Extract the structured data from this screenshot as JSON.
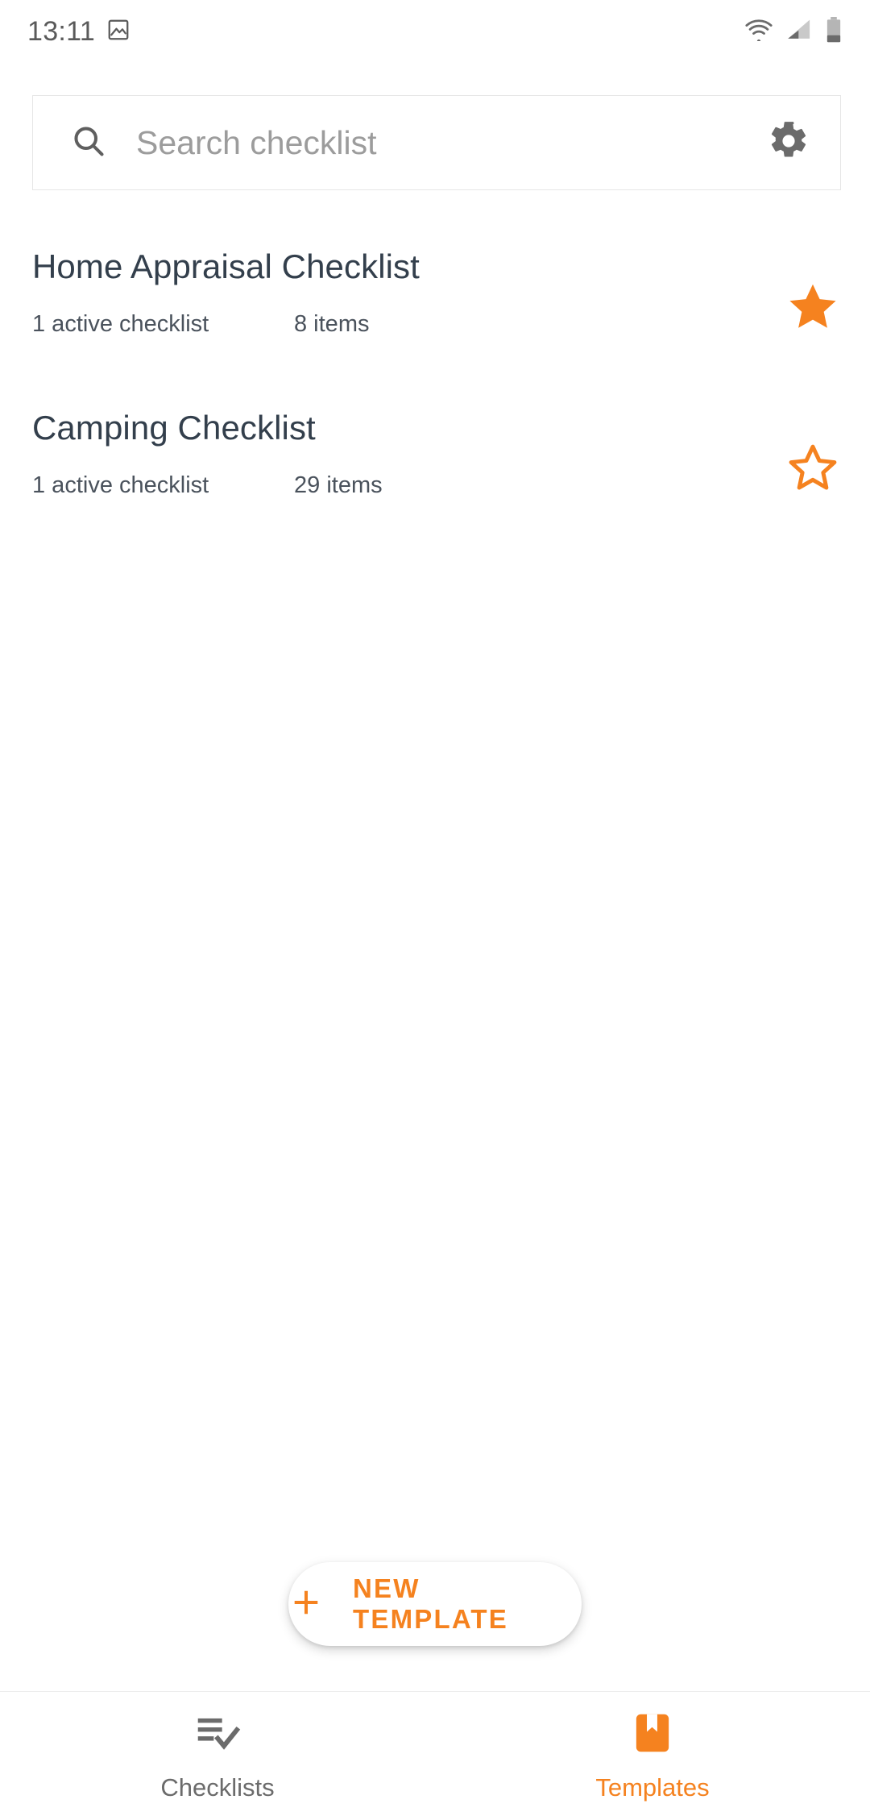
{
  "status_bar": {
    "time": "13:11",
    "icons": [
      "screenshot-image-icon",
      "wifi-icon",
      "cell-signal-icon",
      "battery-icon"
    ],
    "battery_level_pct": 28,
    "wifi_bars": 4,
    "signal_bars": 2
  },
  "search": {
    "placeholder": "Search checklist",
    "value": "",
    "leading_icon": "search-icon",
    "trailing_icon": "gear-icon"
  },
  "templates": [
    {
      "title": "Home Appraisal Checklist",
      "active": "1 active checklist",
      "items": "8 items",
      "favorite": true
    },
    {
      "title": "Camping Checklist",
      "active": "1 active checklist",
      "items": "29 items",
      "favorite": false
    }
  ],
  "fab": {
    "label": "NEW TEMPLATE",
    "icon": "plus-icon"
  },
  "bottom_nav": {
    "items": [
      {
        "label": "Checklists",
        "icon": "playlist-check-icon",
        "active": false
      },
      {
        "label": "Templates",
        "icon": "bookmark-book-icon",
        "active": true
      }
    ]
  },
  "colors": {
    "accent": "#F5821F",
    "title_text": "#333F4C",
    "meta_text": "#4A525C",
    "placeholder": "#9C9C9C",
    "icon_gray": "#6B6B6B",
    "background": "#FFFFFF",
    "divider": "#EDEDED"
  }
}
